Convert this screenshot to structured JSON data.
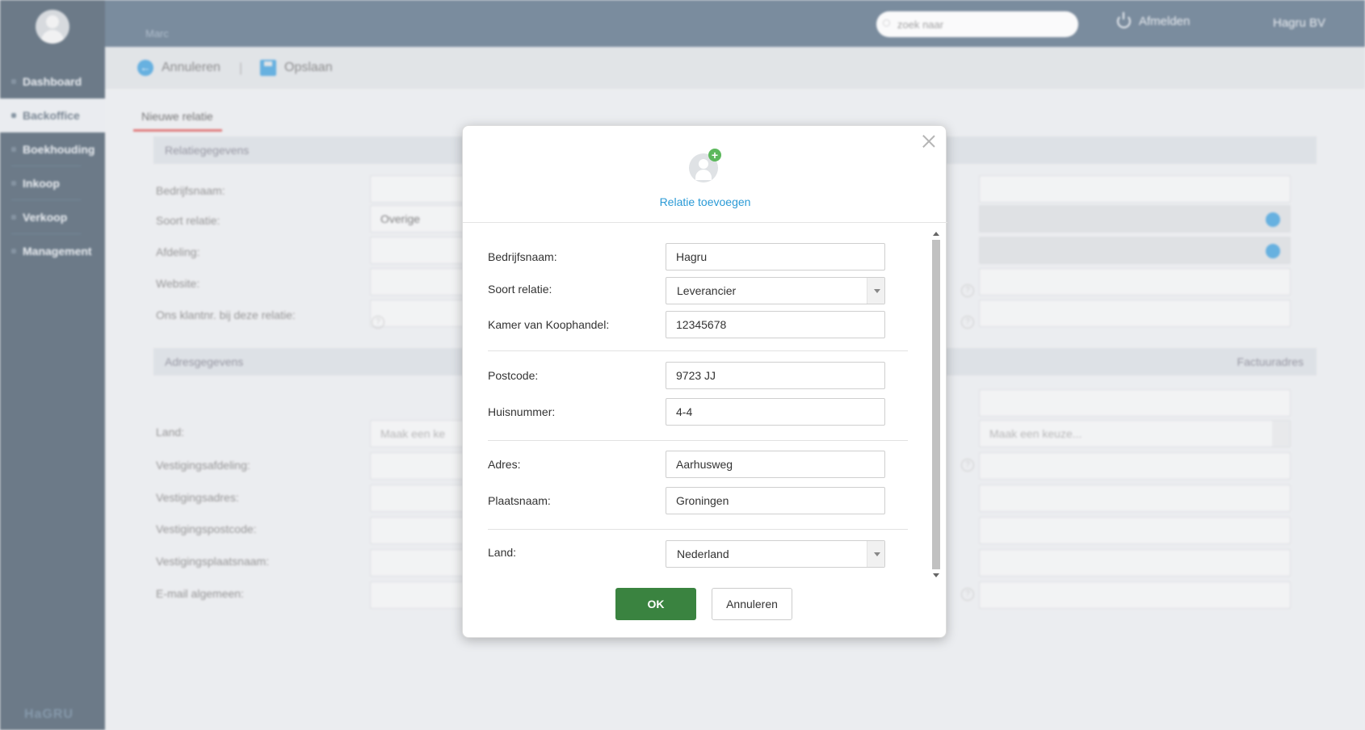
{
  "sidebar": {
    "items": [
      {
        "label": "Dashboard"
      },
      {
        "label": "Backoffice"
      },
      {
        "label": "Boekhouding"
      },
      {
        "label": "Inkoop"
      },
      {
        "label": "Verkoop"
      },
      {
        "label": "Management"
      }
    ],
    "logo": "HaGRU"
  },
  "topbar": {
    "user": "Marc",
    "search_placeholder": "zoek naar",
    "logout": "Afmelden",
    "company": "Hagru BV"
  },
  "toolbar": {
    "cancel": "Annuleren",
    "save": "Opslaan"
  },
  "page": {
    "tab": "Nieuwe relatie",
    "section_relation": "Relatiegegevens",
    "section_address": "Adresgegevens",
    "section_invoice": "Factuuradres",
    "labels": {
      "company": "Bedrijfsnaam:",
      "relation_type": "Soort relatie:",
      "department": "Afdeling:",
      "website": "Website:",
      "our_customer_no": "Ons klantnr. bij deze relatie:",
      "country": "Land:",
      "branch_dept": "Vestigingsafdeling:",
      "branch_address": "Vestigingsadres:",
      "branch_postcode": "Vestigingspostcode:",
      "branch_city": "Vestigingsplaatsnaam:",
      "email": "E-mail algemeen:"
    },
    "relation_type_value": "Overige",
    "country_placeholder": "Maak een keuze...",
    "country_placeholder_cut": "Maak een ke"
  },
  "modal": {
    "title": "Relatie toevoegen",
    "fields": {
      "company_label": "Bedrijfsnaam:",
      "company_value": "Hagru",
      "type_label": "Soort relatie:",
      "type_value": "Leverancier",
      "kvk_label": "Kamer van Koophandel:",
      "kvk_value": "12345678",
      "postcode_label": "Postcode:",
      "postcode_value": "9723 JJ",
      "house_label": "Huisnummer:",
      "house_value": "4-4",
      "address_label": "Adres:",
      "address_value": "Aarhusweg",
      "city_label": "Plaatsnaam:",
      "city_value": "Groningen",
      "country_label": "Land:",
      "country_value": "Nederland"
    },
    "ok": "OK",
    "cancel": "Annuleren"
  },
  "colors": {
    "sidebar": "#253b4f",
    "topbar": "#3b5670",
    "accent_blue": "#2a9ad6",
    "ok_green": "#3a8340",
    "tab_underline": "#d83b3b"
  }
}
